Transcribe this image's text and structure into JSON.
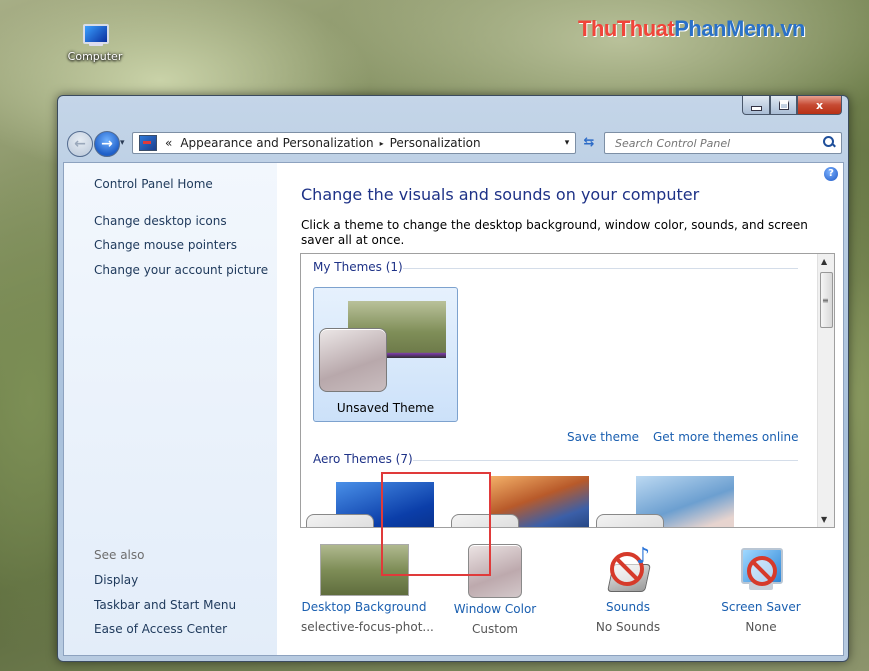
{
  "desktop": {
    "icon_label": "Computer"
  },
  "watermark": {
    "part1": "ThuThuat",
    "part2": "PhanMem.vn"
  },
  "window": {
    "caption": {
      "minimize": "–",
      "maximize": "□",
      "close": "x"
    },
    "nav": {
      "back_glyph": "←",
      "forward_glyph": "→",
      "history_glyph": "▾",
      "address": {
        "prefix": "«",
        "segments": [
          "Appearance and Personalization",
          "Personalization"
        ],
        "separator": "▸",
        "dropdown_glyph": "▾"
      },
      "refresh_glyph": "⇆",
      "search_placeholder": "Search Control Panel"
    },
    "sidebar": {
      "home": "Control Panel Home",
      "links": [
        "Change desktop icons",
        "Change mouse pointers",
        "Change your account picture"
      ],
      "see_also_label": "See also",
      "see_also": [
        "Display",
        "Taskbar and Start Menu",
        "Ease of Access Center"
      ]
    },
    "main": {
      "help_glyph": "?",
      "title": "Change the visuals and sounds on your computer",
      "description": "Click a theme to change the desktop background, window color, sounds, and screen saver all at once.",
      "my_themes_header": "My Themes (1)",
      "unsaved_theme_label": "Unsaved Theme",
      "save_theme": "Save theme",
      "get_more_themes": "Get more themes online",
      "aero_themes_header": "Aero Themes (7)",
      "scrollbar": {
        "up": "▲",
        "down": "▼",
        "grip": "≡"
      }
    },
    "bottom": {
      "items": [
        {
          "label": "Desktop Background",
          "sub": "selective-focus-phot...",
          "icon": "desktop-background-icon"
        },
        {
          "label": "Window Color",
          "sub": "Custom",
          "icon": "window-color-icon"
        },
        {
          "label": "Sounds",
          "sub": "No Sounds",
          "icon": "sounds-icon"
        },
        {
          "label": "Screen Saver",
          "sub": "None",
          "icon": "screen-saver-icon"
        }
      ],
      "sounds_note_glyph": "♪"
    }
  },
  "colors": {
    "title_blue": "#1e3287",
    "link_blue": "#1a5fb0",
    "highlight_red": "#e03a3a"
  }
}
